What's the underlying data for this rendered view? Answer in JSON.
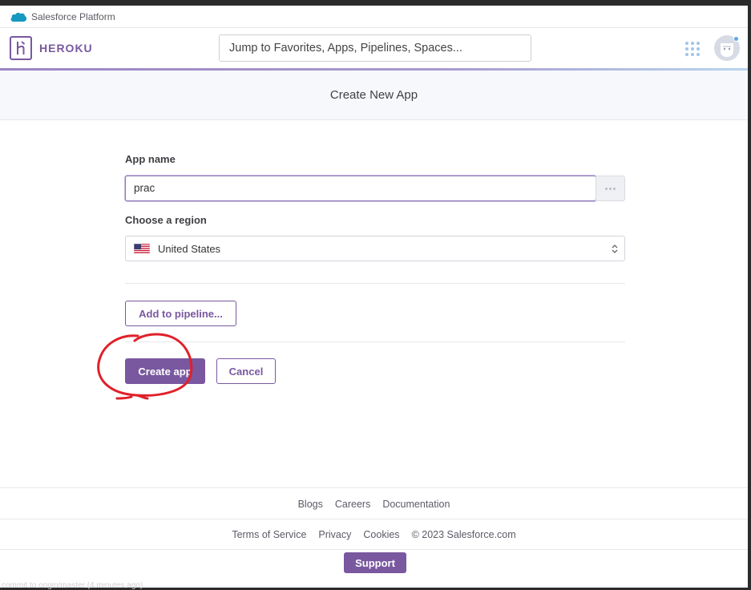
{
  "salesforce_bar": {
    "text": "Salesforce Platform"
  },
  "header": {
    "logo_text": "HEROKU",
    "search_placeholder": "Jump to Favorites, Apps, Pipelines, Spaces..."
  },
  "page": {
    "title": "Create New App"
  },
  "form": {
    "app_name_label": "App name",
    "app_name_value": "prac",
    "region_label": "Choose a region",
    "region_value": "United States",
    "add_pipeline_label": "Add to pipeline...",
    "create_label": "Create app",
    "cancel_label": "Cancel"
  },
  "footer": {
    "links_row1": [
      "Blogs",
      "Careers",
      "Documentation"
    ],
    "links_row2": [
      "Terms of Service",
      "Privacy",
      "Cookies",
      "© 2023 Salesforce.com"
    ],
    "support_label": "Support"
  },
  "status_bar": {
    "text": "commit to origin/master (4 minutes ago)"
  },
  "colors": {
    "brand": "#79589f",
    "annotation": "#e0202a",
    "subheader_bg": "#f7f8fb",
    "salesforce_blue": "#1798c1"
  },
  "icons": {
    "salesforce_logo": "cloud-icon",
    "heroku_logo": "heroku-h-icon",
    "apps_grid": "grid-icon",
    "avatar": "user-avatar-icon",
    "region_flag": "us-flag-icon",
    "select_arrow": "up-down-chevron-icon"
  }
}
